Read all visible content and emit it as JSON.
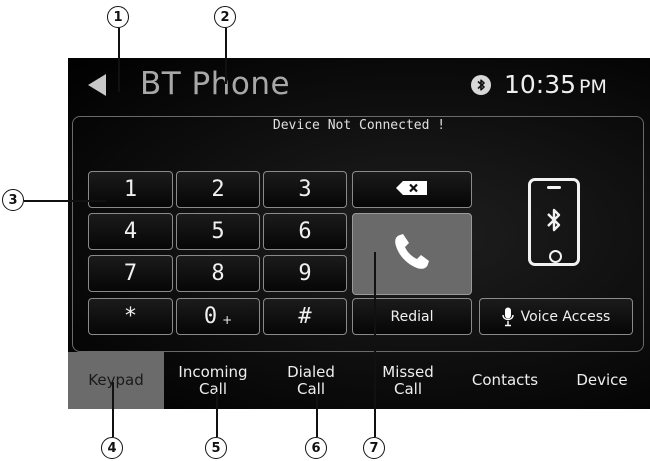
{
  "header": {
    "title": "BT Phone",
    "time": "10:35",
    "ampm": "PM"
  },
  "status_message": "Device Not Connected !",
  "keypad": {
    "keys": [
      "1",
      "2",
      "3",
      "4",
      "5",
      "6",
      "7",
      "8",
      "9",
      "*",
      "0",
      "#"
    ],
    "zero_sub": "+"
  },
  "redial_label": "Redial",
  "voice_access_label": "Voice Access",
  "tabs": [
    {
      "label": "Keypad"
    },
    {
      "label": "Incoming\nCall"
    },
    {
      "label": "Dialed\nCall"
    },
    {
      "label": "Missed\nCall"
    },
    {
      "label": "Contacts"
    },
    {
      "label": "Device"
    }
  ],
  "callouts": [
    "1",
    "2",
    "3",
    "4",
    "5",
    "6",
    "7"
  ],
  "icons": {
    "back": "back-arrow-icon",
    "bluetooth": "bluetooth-icon",
    "backspace": "backspace-icon",
    "call": "phone-handset-icon",
    "microphone": "microphone-icon",
    "device": "smartphone-bluetooth-icon"
  }
}
